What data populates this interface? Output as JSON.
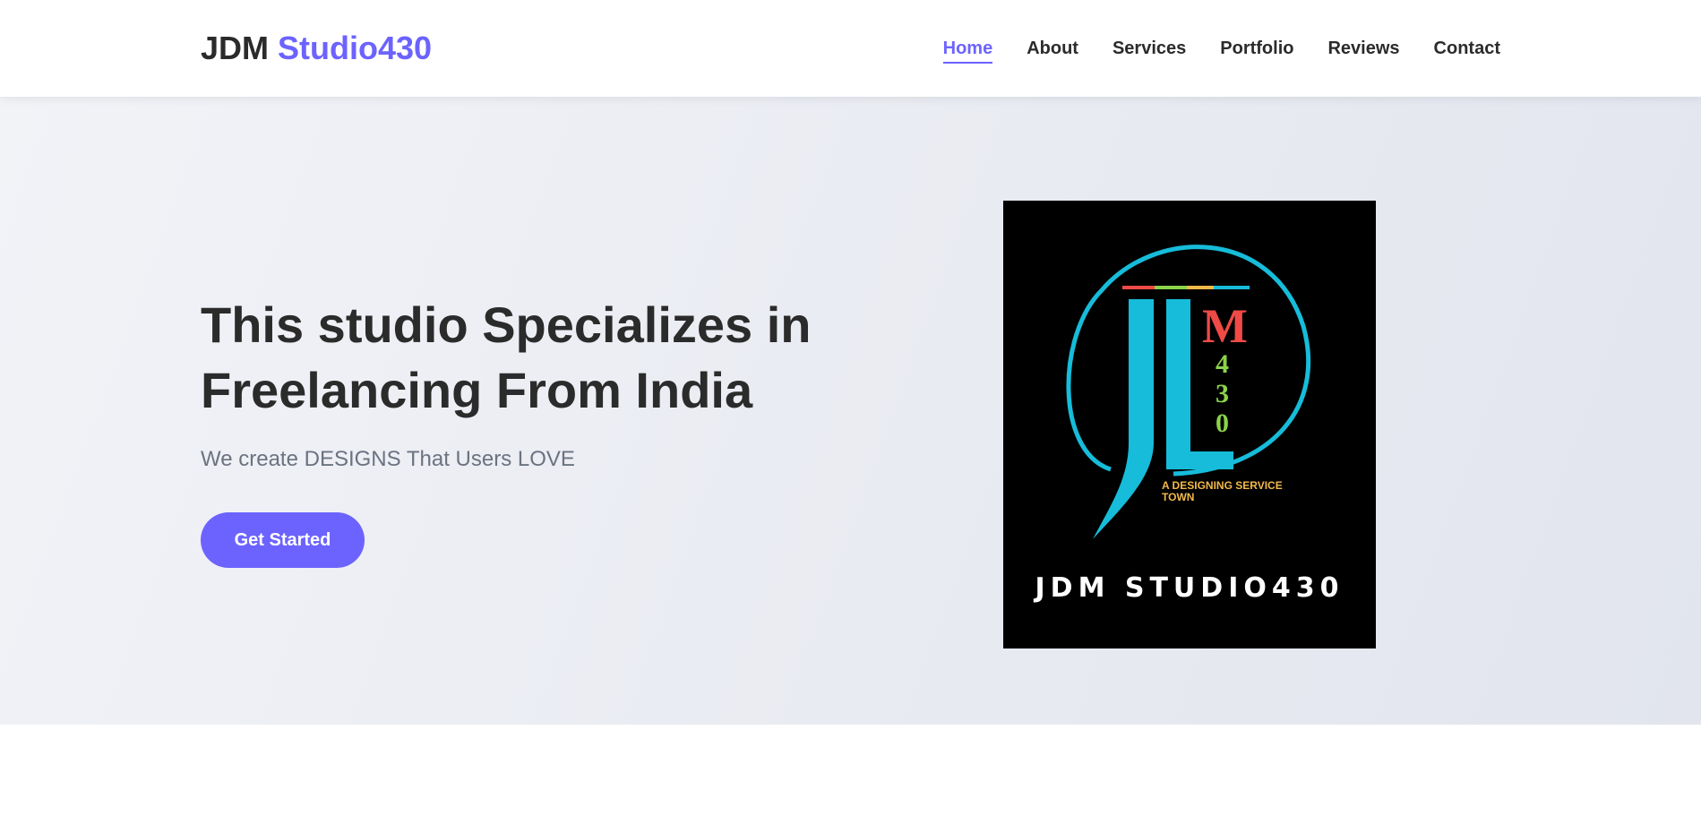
{
  "brand": {
    "name_part1": "JDM",
    "name_part2": "Studio430"
  },
  "nav": {
    "items": [
      "Home",
      "About",
      "Services",
      "Portfolio",
      "Reviews",
      "Contact"
    ],
    "active": "Home"
  },
  "hero": {
    "title": "This studio Specializes in Freelancing From India",
    "subtitle": "We create DESIGNS That Users LOVE",
    "cta_label": "Get Started"
  },
  "logo_image": {
    "tagline": "A DESIGNING SERVICE TOWN",
    "wordmark": "JDM STUDIO430",
    "monogram": "JDM 430"
  },
  "colors": {
    "accent": "#6c63ff",
    "text": "#2b2b2b",
    "muted": "#6b7280",
    "logo_cyan": "#16bcd9",
    "logo_red": "#f04a47",
    "logo_green": "#8bd34a",
    "logo_gold": "#f2b94a"
  }
}
